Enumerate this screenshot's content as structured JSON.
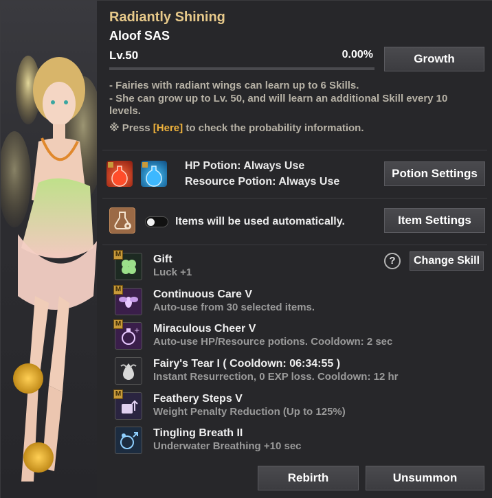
{
  "header": {
    "title": "Radiantly Shining",
    "name": "Aloof SAS",
    "level": "Lv.50",
    "exp_percent": "0.00%",
    "exp_fraction": 0.0,
    "growth_label": "Growth"
  },
  "description": {
    "line1": "- Fairies with radiant wings can learn up to 6 Skills.",
    "line2": "- She can grow up to Lv. 50, and will learn an additional Skill every 10",
    "line3": "levels.",
    "line4_prefix": "※ Press ",
    "line4_link": "[Here]",
    "line4_suffix": " to check the probability information."
  },
  "potions": {
    "hp_label": "HP Potion: Always Use",
    "resource_label": "Resource Potion: Always Use",
    "settings_label": "Potion Settings"
  },
  "items": {
    "auto_text": "Items will be used automatically.",
    "toggle_on": false,
    "settings_label": "Item Settings"
  },
  "skills": {
    "change_label": "Change Skill",
    "help_glyph": "?",
    "list": [
      {
        "name": "Gift",
        "desc": "Luck +1",
        "badge": "M",
        "icon": "clover-icon"
      },
      {
        "name": "Continuous Care V",
        "desc": "Auto-use from 30 selected items.",
        "badge": "M",
        "icon": "fairy-icon"
      },
      {
        "name": "Miraculous Cheer V",
        "desc": "Auto-use HP/Resource potions. Cooldown: 2 sec",
        "badge": "M",
        "icon": "potion-cheer-icon"
      },
      {
        "name": "Fairy's Tear I ( Cooldown: 06:34:55 )",
        "desc": "Instant Resurrection, 0 EXP loss. Cooldown: 12 hr",
        "badge": "",
        "icon": "tear-icon"
      },
      {
        "name": "Feathery Steps V",
        "desc": "Weight Penalty Reduction (Up to 125%)",
        "badge": "M",
        "icon": "weight-icon"
      },
      {
        "name": "Tingling Breath II",
        "desc": "Underwater Breathing +10 sec",
        "badge": "",
        "icon": "breath-icon"
      }
    ]
  },
  "footer": {
    "rebirth_label": "Rebirth",
    "unsummon_label": "Unsummon"
  },
  "colors": {
    "title": "#e7c98a",
    "highlight": "#f0b33c",
    "badge": "#c89a3a"
  }
}
